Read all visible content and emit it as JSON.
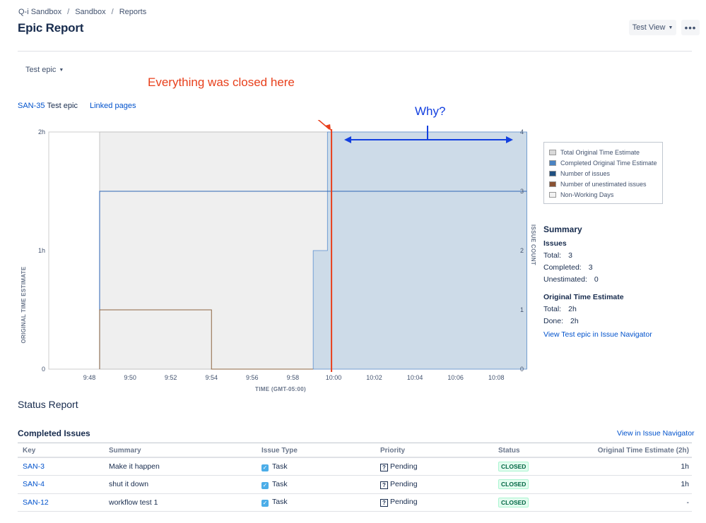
{
  "breadcrumb": [
    "Q-i Sandbox",
    "Sandbox",
    "Reports"
  ],
  "page_title": "Epic Report",
  "view_button": "Test View",
  "more_button": "•••",
  "epic_selector": "Test epic",
  "epic": {
    "key": "SAN-35",
    "name": "Test epic"
  },
  "linked_pages": "Linked pages",
  "annotations": {
    "closed": "Everything was closed here",
    "why": "Why?"
  },
  "colors": {
    "total_estimate": "#efefef",
    "completed_estimate": "#cddbe8",
    "issues_line": "#2d64b3",
    "unestimated_line": "#8d6642",
    "annotation_red": "#e8401c",
    "annotation_blue": "#1340e0"
  },
  "chart_data": {
    "type": "area",
    "xlabel": "TIME (GMT-05:00)",
    "ylabel_left": "ORIGINAL TIME ESTIMATE",
    "ylabel_right": "ISSUE COUNT",
    "x_ticks": [
      "9:48",
      "9:50",
      "9:52",
      "9:54",
      "9:56",
      "9:58",
      "10:00",
      "10:02",
      "10:04",
      "10:06",
      "10:08"
    ],
    "y_left_ticks": [
      "0",
      "1h",
      "2h"
    ],
    "y_right_ticks": [
      "0",
      "1",
      "2",
      "3",
      "4"
    ],
    "ylim_left_hours": [
      0,
      2
    ],
    "ylim_right": [
      0,
      4
    ],
    "xlim_minutes_after_9_46": [
      0,
      23
    ],
    "series": [
      {
        "name": "Total Original Time Estimate",
        "points": [
          [
            "9:48.5",
            2
          ],
          [
            "10:09.5",
            2
          ]
        ]
      },
      {
        "name": "Completed Original Time Estimate",
        "points": [
          [
            "9:59",
            1
          ],
          [
            "9:59.7",
            2
          ],
          [
            "10:09.5",
            2
          ]
        ]
      },
      {
        "name": "Number of issues",
        "points": [
          [
            "9:48.5",
            3
          ],
          [
            "10:09.5",
            3
          ]
        ]
      },
      {
        "name": "Number of unestimated issues",
        "points": [
          [
            "9:48.5",
            1
          ],
          [
            "9:54",
            0
          ]
        ]
      }
    ],
    "legend": [
      "Total Original Time Estimate",
      "Completed Original Time Estimate",
      "Number of issues",
      "Number of unestimated issues",
      "Non-Working Days"
    ],
    "legend_colors": [
      "#d9d9d9",
      "#4a83c2",
      "#205081",
      "#8a5233",
      "#f2f2f2"
    ],
    "legend_position": "right"
  },
  "summary": {
    "title": "Summary",
    "issues_title": "Issues",
    "issues": [
      {
        "label": "Total:",
        "value": "3"
      },
      {
        "label": "Completed:",
        "value": "3"
      },
      {
        "label": "Unestimated:",
        "value": "0"
      }
    ],
    "estimate_title": "Original Time Estimate",
    "estimate": [
      {
        "label": "Total:",
        "value": "2h"
      },
      {
        "label": "Done:",
        "value": "2h"
      }
    ],
    "navigator_link": "View Test epic in Issue Navigator"
  },
  "status_report": "Status Report",
  "completed_issues": {
    "title": "Completed Issues",
    "view_link": "View in Issue Navigator",
    "columns": [
      "Key",
      "Summary",
      "Issue Type",
      "Priority",
      "Status",
      "Original Time Estimate (2h)"
    ],
    "rows": [
      {
        "key": "SAN-3",
        "summary": "Make it happen",
        "type": "Task",
        "priority": "Pending",
        "status": "CLOSED",
        "estimate": "1h"
      },
      {
        "key": "SAN-4",
        "summary": "shut it down",
        "type": "Task",
        "priority": "Pending",
        "status": "CLOSED",
        "estimate": "1h"
      },
      {
        "key": "SAN-12",
        "summary": "workflow test 1",
        "type": "Task",
        "priority": "Pending",
        "status": "CLOSED",
        "estimate": "-"
      }
    ]
  }
}
